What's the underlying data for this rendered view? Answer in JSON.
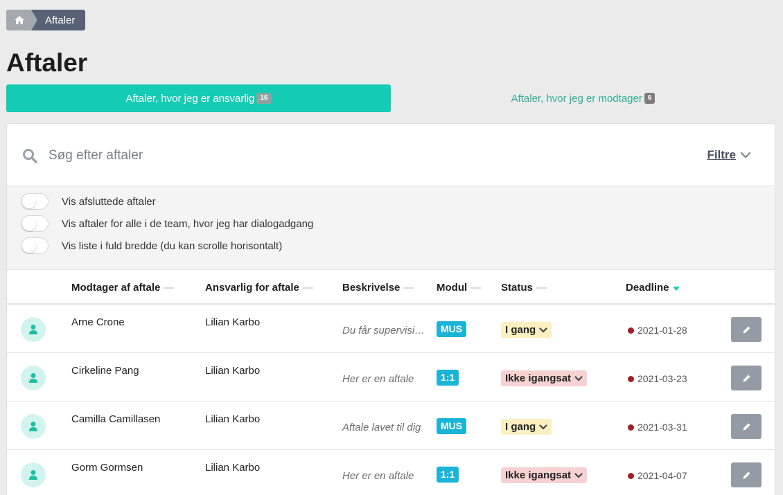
{
  "breadcrumb": {
    "home_icon": "home-icon",
    "current": "Aftaler"
  },
  "page": {
    "title": "Aftaler"
  },
  "tabs": [
    {
      "label": "Aftaler, hvor jeg er ansvarlig",
      "count": "16",
      "active": true
    },
    {
      "label": "Aftaler, hvor jeg er modtager",
      "count": "6",
      "active": false
    }
  ],
  "search": {
    "placeholder": "Søg efter aftaler",
    "value": ""
  },
  "filters": {
    "label": "Filtre"
  },
  "toggles": [
    {
      "label": "Vis afsluttede aftaler",
      "on": false
    },
    {
      "label": "Vis aftaler for alle i de team, hvor jeg har dialogadgang",
      "on": false
    },
    {
      "label": "Vis liste i fuld bredde (du kan scrolle horisontalt)",
      "on": false
    }
  ],
  "table": {
    "columns": {
      "recipient": "Modtager af aftale",
      "responsible": "Ansvarlig for aftale",
      "description": "Beskrivelse",
      "module": "Modul",
      "status": "Status",
      "deadline": "Deadline"
    },
    "sort_marker": "—",
    "rows": [
      {
        "recipient": "Arne Crone",
        "responsible": "Lilian Karbo",
        "description": "Du får supervision",
        "module": "MUS",
        "status": "I gang",
        "status_kind": "in-progress",
        "deadline": "2021-01-28"
      },
      {
        "recipient": "Cirkeline Pang",
        "responsible": "Lilian Karbo",
        "description": "Her er en aftale",
        "module": "1:1",
        "status": "Ikke igangsat",
        "status_kind": "not-started",
        "deadline": "2021-03-23"
      },
      {
        "recipient": "Camilla Camillasen",
        "responsible": "Lilian Karbo",
        "description": "Aftale lavet til dig",
        "module": "MUS",
        "status": "I gang",
        "status_kind": "in-progress",
        "deadline": "2021-03-31"
      },
      {
        "recipient": "Gorm Gormsen",
        "responsible": "Lilian Karbo",
        "description": "Her er en aftale",
        "module": "1:1",
        "status": "Ikke igangsat",
        "status_kind": "not-started",
        "deadline": "2021-04-07"
      }
    ]
  },
  "colors": {
    "accent": "#14ccb4",
    "module_badge": "#1ab4d7",
    "status_in_progress": "#fcefc1",
    "status_not_started": "#f7d2d3",
    "deadline_dot": "#a01f26"
  }
}
